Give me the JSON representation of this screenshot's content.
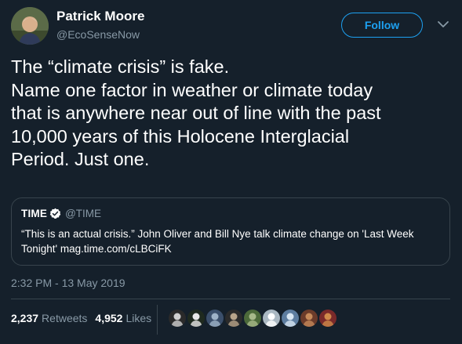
{
  "author": {
    "name": "Patrick Moore",
    "handle": "@EcoSenseNow"
  },
  "follow_button": {
    "label": "Follow"
  },
  "tweet": {
    "lines": [
      "The “climate crisis” is fake.",
      "Name one factor in weather or climate today",
      "that is anywhere near out of line with the past",
      "10,000 years of this Holocene Interglacial",
      "Period. Just one."
    ]
  },
  "quote": {
    "name": "TIME",
    "handle": "@TIME",
    "text": "“This is an actual crisis.” John Oliver and Bill Nye talk climate change on 'Last Week Tonight' mag.time.com/cLBCiFK"
  },
  "timestamp": "2:32 PM - 13 May 2019",
  "stats": {
    "retweets_count": "2,237",
    "retweets_label": "Retweets",
    "likes_count": "4,952",
    "likes_label": "Likes"
  },
  "colors": {
    "background": "#15202b",
    "accent": "#1da1f2",
    "muted": "#8899a6",
    "border": "#38444d"
  },
  "icons": {
    "verified": "verified-badge-icon",
    "chevron": "chevron-down-icon"
  },
  "likers": [
    {
      "colors": [
        "#2a2a2a",
        "#cfcfcf"
      ]
    },
    {
      "colors": [
        "#1f2a1f",
        "#e8e8e8"
      ]
    },
    {
      "colors": [
        "#3b4f6b",
        "#9fb3c8"
      ]
    },
    {
      "colors": [
        "#2b2b2b",
        "#b8a48a"
      ]
    },
    {
      "colors": [
        "#4c6a3a",
        "#a7b98a"
      ]
    },
    {
      "colors": [
        "#aab8c2",
        "#ffffff"
      ]
    },
    {
      "colors": [
        "#5d7da0",
        "#d8e6f2"
      ]
    },
    {
      "colors": [
        "#6b3b2a",
        "#c68a5a"
      ]
    },
    {
      "colors": [
        "#7a2a2a",
        "#d08a4a"
      ]
    }
  ]
}
